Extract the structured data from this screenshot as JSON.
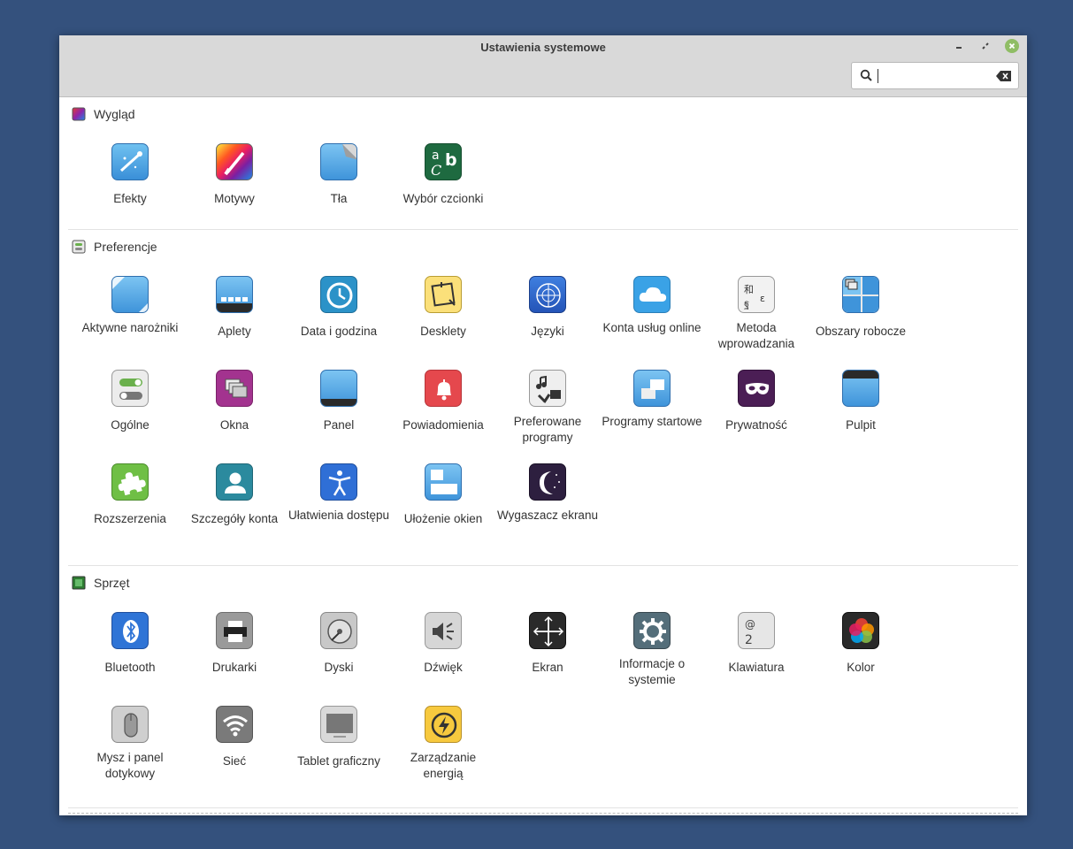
{
  "window": {
    "title": "Ustawienia systemowe",
    "search_value": ""
  },
  "sections": {
    "appearance": {
      "title": "Wygląd",
      "items": [
        "Efekty",
        "Motywy",
        "Tła",
        "Wybór czcionki"
      ]
    },
    "preferences": {
      "title": "Preferencje",
      "items": [
        "Aktywne narożniki",
        "Aplety",
        "Data i godzina",
        "Desklety",
        "Języki",
        "Konta usług online",
        "Metoda wprowadzania",
        "Obszary robocze",
        "Ogólne",
        "Okna",
        "Panel",
        "Powiadomienia",
        "Preferowane programy",
        "Programy startowe",
        "Prywatność",
        "Pulpit",
        "Rozszerzenia",
        "Szczegóły konta",
        "Ułatwienia dostępu",
        "Ułożenie okien",
        "Wygaszacz ekranu"
      ]
    },
    "hardware": {
      "title": "Sprzęt",
      "items": [
        "Bluetooth",
        "Drukarki",
        "Dyski",
        "Dźwięk",
        "Ekran",
        "Informacje o systemie",
        "Klawiatura",
        "Kolor",
        "Mysz i panel dotykowy",
        "Sieć",
        "Tablet graficzny",
        "Zarządzanie energią"
      ]
    }
  },
  "icon_text": {
    "font_a": "a",
    "font_b": "b",
    "font_c": "C",
    "input_cjk": "和",
    "input_thai": "ฐ",
    "input_e": "ɛ",
    "keyboard_at": "@",
    "keyboard_2": "2"
  }
}
